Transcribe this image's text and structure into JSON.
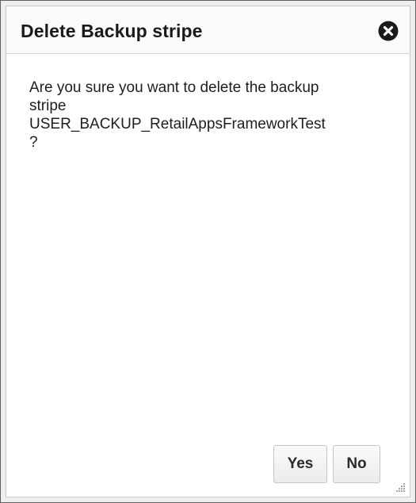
{
  "dialog": {
    "title": "Delete Backup stripe",
    "message_lines": [
      "Are you sure you want to delete the backup",
      "stripe",
      "USER_BACKUP_RetailAppsFrameworkTest",
      "?"
    ],
    "close_icon": "close-circle-icon",
    "buttons": {
      "yes_label": "Yes",
      "no_label": "No"
    },
    "resize_icon": "resize-grip-icon"
  },
  "colors": {
    "frame": "#eeeeee",
    "border": "#5f5f5f",
    "text": "#1e1e1e",
    "button_bg": "#f3f3f3"
  }
}
